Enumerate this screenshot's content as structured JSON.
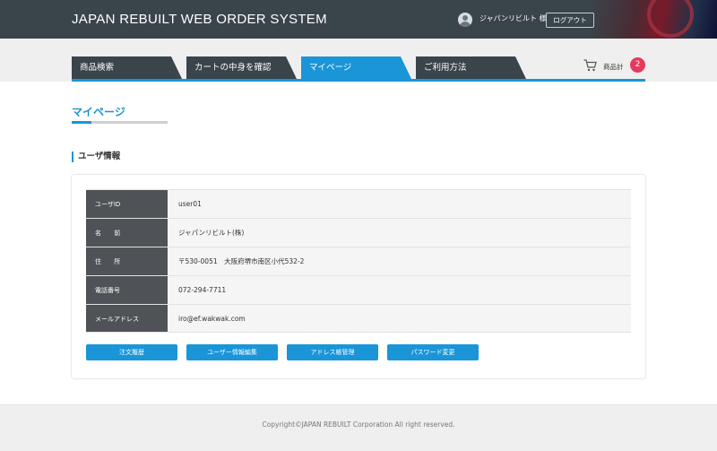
{
  "header": {
    "brand": "JAPAN REBUILT WEB ORDER SYSTEM",
    "user_name": "ジャパンリビルト 様",
    "logout_label": "ログアウト"
  },
  "nav": {
    "tabs": [
      {
        "label": "商品検索",
        "active": false
      },
      {
        "label": "カートの中身を確認",
        "active": false
      },
      {
        "label": "マイページ",
        "active": true
      },
      {
        "label": "ご利用方法",
        "active": false
      }
    ],
    "cart_label": "商品計",
    "cart_count": "2"
  },
  "page": {
    "title": "マイページ",
    "section_title": "ユーザ情報"
  },
  "user_info": {
    "rows": [
      {
        "label": "ユーザID",
        "value": "user01"
      },
      {
        "label": "名 前",
        "value": "ジャパンリビルト(株)"
      },
      {
        "label": "住 所",
        "value": "〒530-0051　大阪府堺市南区小代532-2"
      },
      {
        "label": "電話番号",
        "value": "072-294-7711"
      },
      {
        "label": "メールアドレス",
        "value": "iro@ef.wakwak.com"
      }
    ]
  },
  "actions": {
    "order_history": "注文履歴",
    "edit_user": "ユーザー情報編集",
    "address_book": "アドレス帳管理",
    "change_password": "パスワード変更"
  },
  "footer": {
    "copyright": "Copyright©JAPAN REBUILT Corporation All right reserved."
  },
  "colors": {
    "accent": "#1a95d8",
    "header_bg": "#3a444b",
    "badge": "#e63a5c"
  }
}
